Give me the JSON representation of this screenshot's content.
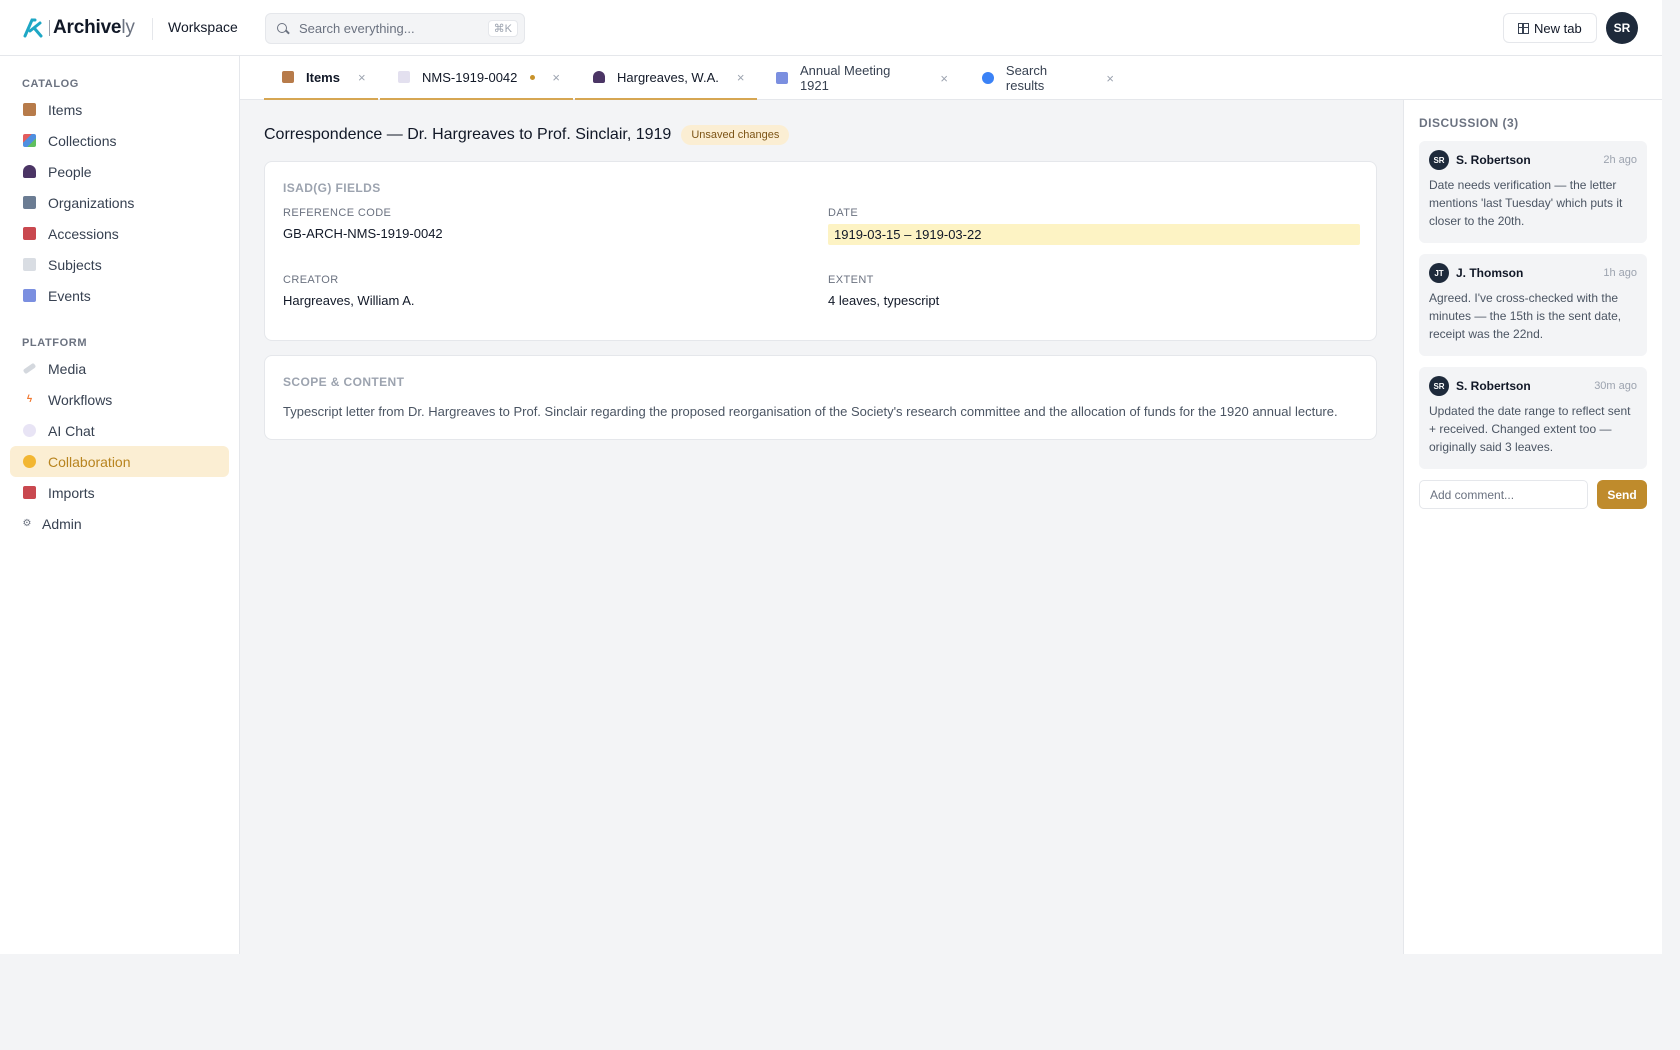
{
  "app": {
    "brand_main": "Archive",
    "brand_light": "ly",
    "workspace": "Workspace",
    "search_placeholder": "Search everything...",
    "search_shortcut": "⌘K",
    "new_tab_label": "New tab",
    "user_initials": "SR"
  },
  "sidebar": {
    "catalog_label": "CATALOG",
    "platform_label": "PLATFORM",
    "catalog_items": [
      {
        "label": "Items",
        "icon": "box-icon"
      },
      {
        "label": "Collections",
        "icon": "collections-icon"
      },
      {
        "label": "People",
        "icon": "person-icon"
      },
      {
        "label": "Organizations",
        "icon": "building-icon"
      },
      {
        "label": "Accessions",
        "icon": "inbox-icon"
      },
      {
        "label": "Subjects",
        "icon": "tag-icon"
      },
      {
        "label": "Events",
        "icon": "calendar-icon"
      }
    ],
    "platform_items": [
      {
        "label": "Media",
        "icon": "paperclip-icon"
      },
      {
        "label": "Workflows",
        "icon": "lightning-icon"
      },
      {
        "label": "AI Chat",
        "icon": "chat-icon"
      },
      {
        "label": "Collaboration",
        "icon": "handshake-icon",
        "active": true
      },
      {
        "label": "Imports",
        "icon": "inbox-icon"
      },
      {
        "label": "Admin",
        "icon": "gear-icon"
      }
    ]
  },
  "tabs": [
    {
      "label": "Items",
      "icon": "box-icon"
    },
    {
      "label": "NMS-1919-0042",
      "icon": "document-icon",
      "unsaved": true
    },
    {
      "label": "Hargreaves, W.A.",
      "icon": "person-icon"
    },
    {
      "label": "Annual Meeting 1921",
      "icon": "calendar-icon"
    },
    {
      "label": "Search results",
      "icon": "magnifier-icon"
    }
  ],
  "record": {
    "title": "Correspondence — Dr. Hargreaves to Prof. Sinclair, 1919",
    "badge": "Unsaved changes",
    "fields_heading": "ISAD(G) FIELDS",
    "reference_code_label": "REFERENCE CODE",
    "reference_code": "GB-ARCH-NMS-1919-0042",
    "date_label": "DATE",
    "date": "1919-03-15 – 1919-03-22",
    "creator_label": "CREATOR",
    "creator": "Hargreaves, William A.",
    "extent_label": "EXTENT",
    "extent": "4 leaves, typescript",
    "scope_heading": "SCOPE & CONTENT",
    "scope_text": "Typescript letter from Dr. Hargreaves to Prof. Sinclair regarding the proposed reorganisation of the Society's research committee and the allocation of funds for the 1920 annual lecture."
  },
  "discussion": {
    "heading": "DISCUSSION (3)",
    "comments": [
      {
        "initials": "SR",
        "author": "S. Robertson",
        "time": "2h ago",
        "text": "Date needs verification — the letter mentions 'last Tuesday' which puts it closer to the 20th."
      },
      {
        "initials": "JT",
        "author": "J. Thomson",
        "time": "1h ago",
        "text": "Agreed. I've cross-checked with the minutes — the 15th is the sent date, receipt was the 22nd."
      },
      {
        "initials": "SR",
        "author": "S. Robertson",
        "time": "30m ago",
        "text": "Updated the date range to reflect sent + received. Changed extent too — originally said 3 leaves."
      }
    ],
    "input_placeholder": "Add comment...",
    "send_label": "Send"
  },
  "colors": {
    "accent": "#bf8b2c",
    "active_bg": "#fbeed3",
    "date_highlight": "#fdf3c4",
    "avatar": "#1e2a3b"
  }
}
